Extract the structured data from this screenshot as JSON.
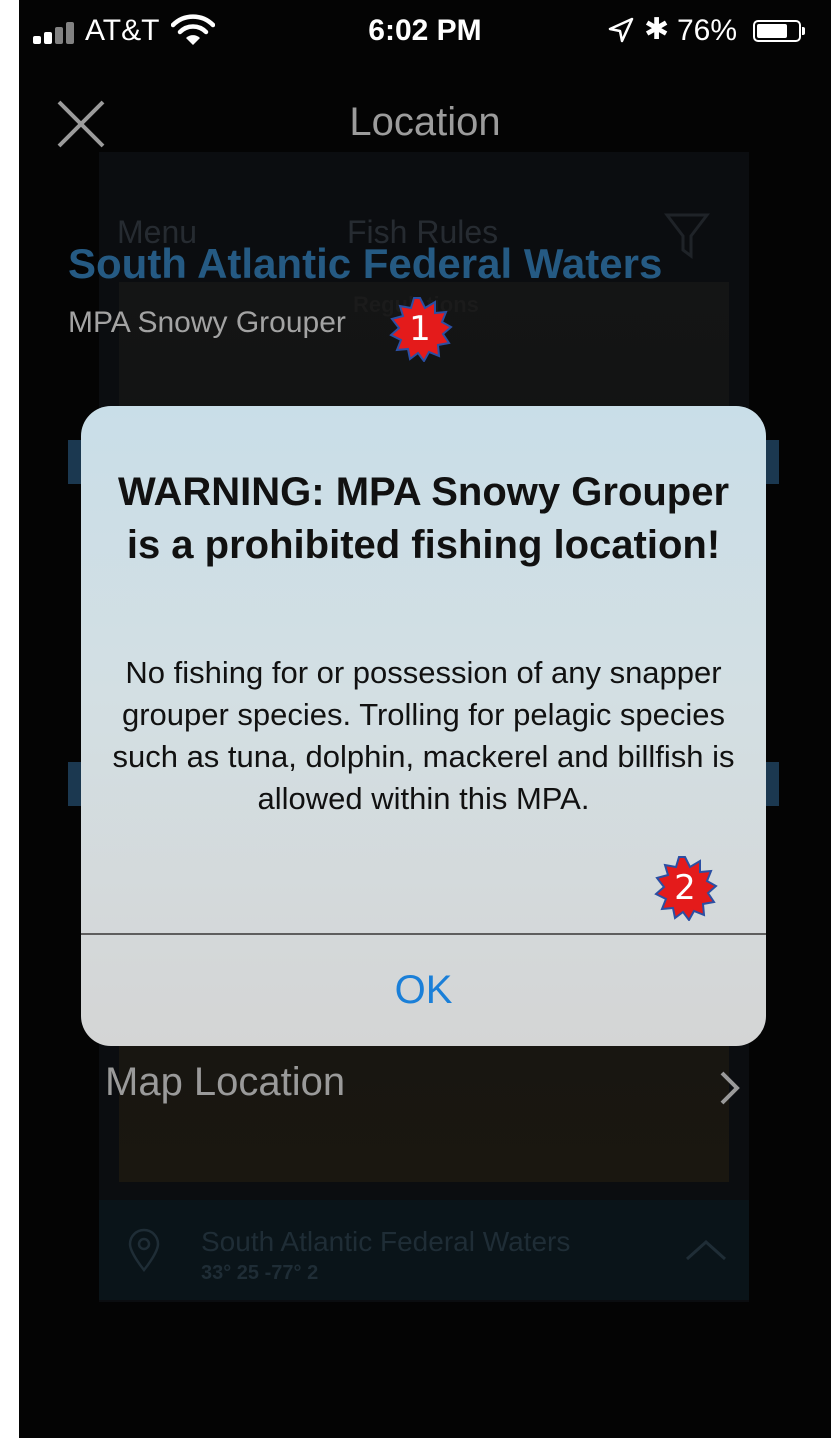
{
  "status_bar": {
    "carrier": "AT&T",
    "time": "6:02 PM",
    "battery_text": "76%",
    "battery_level": 0.76
  },
  "nav": {
    "title": "Location"
  },
  "background": {
    "menu_label": "Menu",
    "fish_rules_label": "Fish Rules",
    "regulations_label": "Regulations",
    "location_heading": "South Atlantic Federal Waters",
    "location_subtitle": "MPA Snowy Grouper",
    "map_location_label": "Map Location",
    "footer_title": "South Atlantic Federal Waters",
    "footer_coords": "33° 25  -77° 2"
  },
  "alert": {
    "title": "WARNING: MPA Snowy Grouper is a prohibited fishing location!",
    "message": "No fishing for or possession of any snapper grouper species. Trolling for pelagic species such as tuna, dolphin, mackerel and billfish is allowed within this MPA.",
    "ok_label": "OK"
  },
  "annotations": {
    "badge_1": "1",
    "badge_2": "2"
  },
  "colors": {
    "heading_blue": "#255a83",
    "ok_blue": "#1a7fd8",
    "badge_red": "#e41b1b",
    "badge_border": "#2b4fa3"
  }
}
